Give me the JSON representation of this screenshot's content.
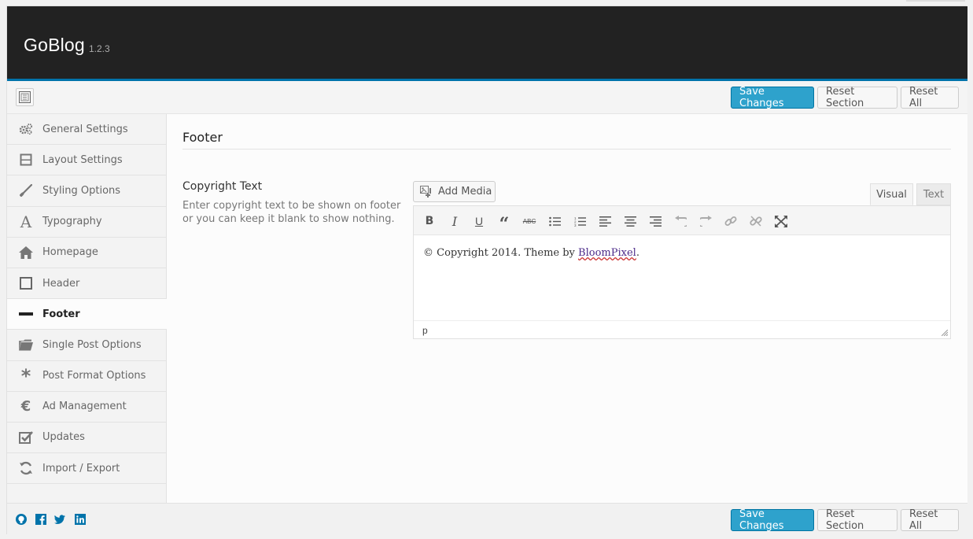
{
  "header": {
    "title": "GoBlog",
    "version": "1.2.3"
  },
  "toolbar": {
    "save_label": "Save Changes",
    "reset_section_label": "Reset Section",
    "reset_all_label": "Reset All"
  },
  "sidebar": {
    "items": [
      {
        "label": "General Settings",
        "icon": "gears-icon"
      },
      {
        "label": "Layout Settings",
        "icon": "layout-icon"
      },
      {
        "label": "Styling Options",
        "icon": "brush-icon"
      },
      {
        "label": "Typography",
        "icon": "typography-icon"
      },
      {
        "label": "Homepage",
        "icon": "home-icon"
      },
      {
        "label": "Header",
        "icon": "square-icon"
      },
      {
        "label": "Footer",
        "icon": "minus-icon",
        "active": true
      },
      {
        "label": "Single Post Options",
        "icon": "folder-icon"
      },
      {
        "label": "Post Format Options",
        "icon": "asterisk-icon"
      },
      {
        "label": "Ad Management",
        "icon": "euro-icon"
      },
      {
        "label": "Updates",
        "icon": "checkbox-icon"
      },
      {
        "label": "Import / Export",
        "icon": "refresh-icon"
      }
    ]
  },
  "main": {
    "section_title": "Footer",
    "field": {
      "title": "Copyright Text",
      "description": "Enter copyright text to be shown on footer or you can keep it blank to show nothing."
    },
    "editor": {
      "add_media_label": "Add Media",
      "tab_visual": "Visual",
      "tab_text": "Text",
      "content_prefix": "© Copyright 2014. Theme by ",
      "content_link": "BloomPixel",
      "content_suffix": ".",
      "status_path": "p"
    }
  },
  "footer": {
    "save_label": "Save Changes",
    "reset_section_label": "Reset Section",
    "reset_all_label": "Reset All",
    "social": [
      "github-icon",
      "facebook-icon",
      "twitter-icon",
      "linkedin-icon"
    ]
  },
  "colors": {
    "primary": "#2ea2cc",
    "header_bg": "#222222",
    "accent": "#0073aa"
  }
}
